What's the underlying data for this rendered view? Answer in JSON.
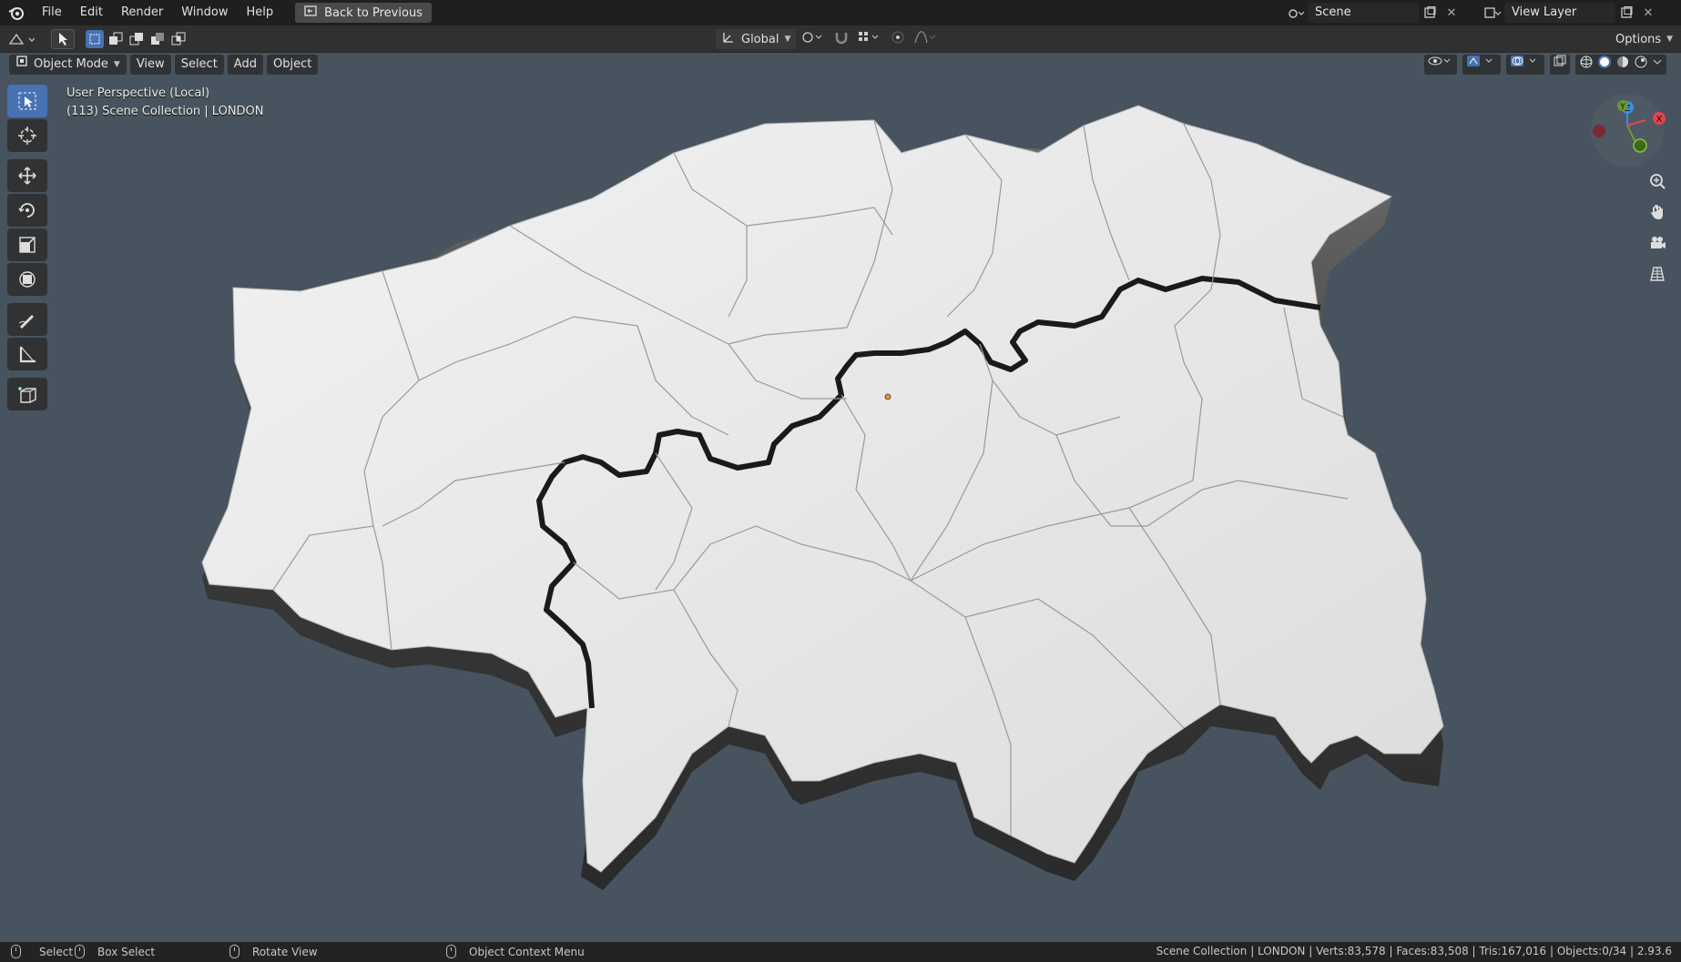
{
  "menu": {
    "items": [
      "File",
      "Edit",
      "Render",
      "Window",
      "Help"
    ],
    "back_label": "Back to Previous"
  },
  "scene": {
    "name": "Scene",
    "view_layer": "View Layer"
  },
  "toolbar": {
    "transform_orientation": "Global",
    "options_label": "Options"
  },
  "viewport_header": {
    "mode": "Object Mode",
    "view": "View",
    "select": "Select",
    "add": "Add",
    "object": "Object"
  },
  "viewport": {
    "perspective": "User Perspective (Local)",
    "collection": "(113) Scene Collection | LONDON"
  },
  "gizmo": {
    "x": "X",
    "y": "Y",
    "z": "Z"
  },
  "statusbar": {
    "select": "Select",
    "box_select": "Box Select",
    "rotate_view": "Rotate View",
    "context_menu": "Object Context Menu",
    "stats": "Scene Collection | LONDON | Verts:83,578 | Faces:83,508 | Tris:167,016 | Objects:0/34 | 2.93.6"
  },
  "colors": {
    "viewport_bg": "#47535e",
    "map_fill": "#e8e8e8",
    "accent": "#4772b3"
  }
}
